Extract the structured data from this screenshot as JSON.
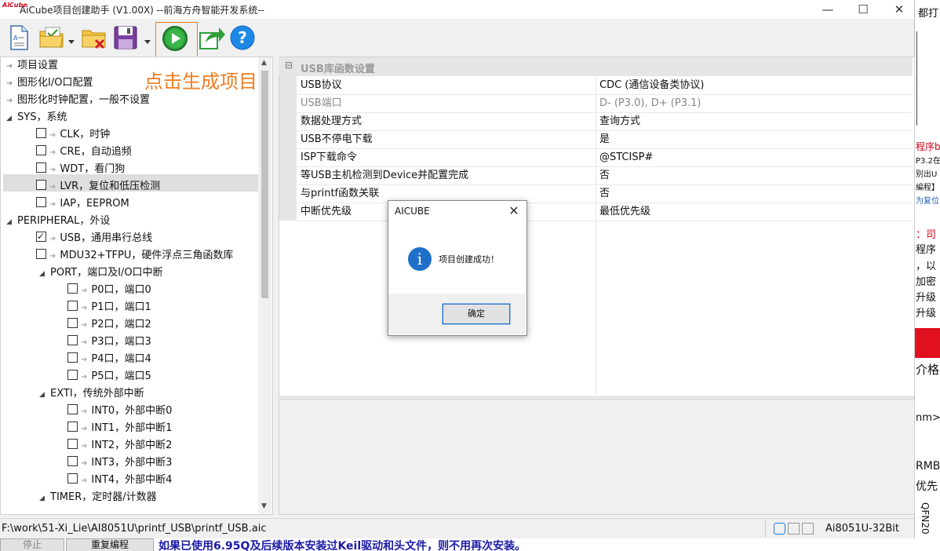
{
  "window": {
    "logo": "AiCube",
    "title": "AiCube项目创建助手 (V1.00X) --前海方舟智能开发系统--",
    "minimize": "—",
    "maximize": "☐",
    "close": "✕"
  },
  "toolbar": {
    "hint": "点击生成项目",
    "icons": [
      "new-file-icon",
      "open-project-icon",
      "close-project-icon",
      "save-icon",
      "run-icon",
      "export-icon",
      "help-icon"
    ],
    "highlight_color": "#ef7d22"
  },
  "tree": {
    "items": [
      {
        "label": "项目设置"
      },
      {
        "label": "图形化I/O口配置"
      },
      {
        "label": "图形化时钟配置，一般不设置"
      },
      {
        "label": "SYS，系统"
      },
      {
        "label": "CLK，时钟"
      },
      {
        "label": "CRE，自动追频"
      },
      {
        "label": "WDT，看门狗"
      },
      {
        "label": "LVR，复位和低压检测"
      },
      {
        "label": "IAP，EEPROM"
      },
      {
        "label": "PERIPHERAL，外设"
      },
      {
        "label": "USB，通用串行总线"
      },
      {
        "label": "MDU32+TFPU，硬件浮点三角函数库"
      },
      {
        "label": "PORT，端口及I/O口中断"
      },
      {
        "label": "P0口，端口0"
      },
      {
        "label": "P1口，端口1"
      },
      {
        "label": "P2口，端口2"
      },
      {
        "label": "P3口，端口3"
      },
      {
        "label": "P4口，端口4"
      },
      {
        "label": "P5口，端口5"
      },
      {
        "label": "EXTI，传统外部中断"
      },
      {
        "label": "INT0，外部中断0"
      },
      {
        "label": "INT1，外部中断1"
      },
      {
        "label": "INT2，外部中断2"
      },
      {
        "label": "INT3，外部中断3"
      },
      {
        "label": "INT4，外部中断4"
      },
      {
        "label": "TIMER，定时器/计数器"
      }
    ]
  },
  "grid": {
    "section": "USB库函数设置",
    "collapse": "⊟",
    "rows": [
      {
        "key": "USB协议",
        "value": "CDC (通信设备类协议)"
      },
      {
        "key": "USB端口",
        "value": "D- (P3.0), D+ (P3.1)"
      },
      {
        "key": "数据处理方式",
        "value": "查询方式"
      },
      {
        "key": "USB不停电下载",
        "value": "是"
      },
      {
        "key": "ISP下载命令",
        "value": "@STCISP#"
      },
      {
        "key": "等USB主机检测到Device并配置完成",
        "value": "否"
      },
      {
        "key": "与printf函数关联",
        "value": "否"
      },
      {
        "key": "中断优先级",
        "value": "最低优先级"
      }
    ]
  },
  "status": {
    "path": "F:\\work\\51-Xi_Lie\\AI8051U\\printf_USB\\printf_USB.aic",
    "chip": "Ai8051U-32Bit"
  },
  "dialog": {
    "title": "AICUBE",
    "close": "✕",
    "icon": "i",
    "message": "项目创建成功！",
    "ok": "确定"
  },
  "background": {
    "bottom_left": "停止",
    "bottom_btn": "重复编程",
    "bottom_text": "如果已使用6.95Q及后续版本安装过Keil驱动和头文件，则不用再次安装。",
    "right_snippets": [
      "都打",
      "程序b",
      "P3.2在",
      "别出U",
      "編程】",
      "为复位",
      "：司",
      "程序",
      "，以",
      "加密",
      "升级",
      "升级",
      "介格",
      "nm>",
      "RMB",
      "优先",
      "QFN20"
    ]
  }
}
